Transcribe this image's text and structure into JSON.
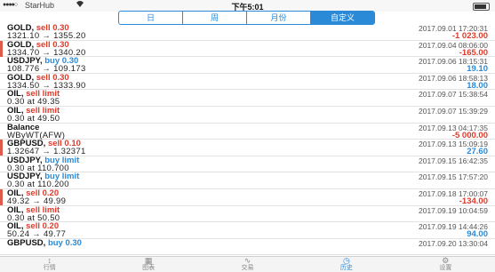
{
  "status_bar": {
    "signal": "●●●●○",
    "carrier": "StarHub",
    "wifi_icon": "wifi-icon",
    "time": "下午5:01",
    "battery_icon": "battery-icon"
  },
  "tabs": [
    {
      "label": "日",
      "active": false
    },
    {
      "label": "周",
      "active": false
    },
    {
      "label": "月份",
      "active": false
    },
    {
      "label": "自定义",
      "active": true
    }
  ],
  "partial_top_row": "1321.10 → 1355.20",
  "rows": [
    {
      "symbol": "GOLD,",
      "side": "sell",
      "side_text": "sell 0.30",
      "prices": "1321.10 → 1355.20",
      "date": "2017.09.01 17:20:31",
      "pnl": "-1 023.00",
      "pnl_sign": "neg",
      "marker": false
    },
    {
      "symbol": "GOLD,",
      "side": "sell",
      "side_text": "sell 0.30",
      "prices": "1334.70 → 1340.20",
      "date": "2017.09.04 08:06:00",
      "pnl": "-165.00",
      "pnl_sign": "neg",
      "marker": true
    },
    {
      "symbol": "USDJPY,",
      "side": "buy",
      "side_text": "buy 0.30",
      "prices": "108.776 → 109.173",
      "date": "2017.09.06 18:15:31",
      "pnl": "19.10",
      "pnl_sign": "pos",
      "marker": false
    },
    {
      "symbol": "GOLD,",
      "side": "sell",
      "side_text": "sell 0.30",
      "prices": "1334.50 → 1333.90",
      "date": "2017.09.06 18:58:13",
      "pnl": "18.00",
      "pnl_sign": "pos",
      "marker": false
    },
    {
      "symbol": "OIL,",
      "side": "sell",
      "side_text": "sell limit",
      "prices": "0.30 at 49.35",
      "date": "2017.09.07 15:38:54",
      "pnl": "",
      "pnl_sign": "",
      "marker": false
    },
    {
      "symbol": "OIL,",
      "side": "sell",
      "side_text": "sell limit",
      "prices": "0.30 at 49.50",
      "date": "2017.09.07 15:39:29",
      "pnl": "",
      "pnl_sign": "",
      "marker": false
    },
    {
      "symbol": "Balance",
      "side": "",
      "side_text": "",
      "prices": "WByWT(AFW)",
      "date": "2017.09.13 04:17:35",
      "pnl": "-5 000.00",
      "pnl_sign": "neg",
      "marker": false
    },
    {
      "symbol": "GBPUSD,",
      "side": "sell",
      "side_text": "sell 0.10",
      "prices": "1.32647 → 1.32371",
      "date": "2017.09.13 15:09:19",
      "pnl": "27.60",
      "pnl_sign": "pos",
      "marker": true
    },
    {
      "symbol": "USDJPY,",
      "side": "buy",
      "side_text": "buy limit",
      "prices": "0.30 at 110.700",
      "date": "2017.09.15 16:42:35",
      "pnl": "",
      "pnl_sign": "",
      "marker": false
    },
    {
      "symbol": "USDJPY,",
      "side": "buy",
      "side_text": "buy limit",
      "prices": "0.30 at 110.200",
      "date": "2017.09.15 17:57:20",
      "pnl": "",
      "pnl_sign": "",
      "marker": false
    },
    {
      "symbol": "OIL,",
      "side": "sell",
      "side_text": "sell 0.20",
      "prices": "49.32 → 49.99",
      "date": "2017.09.18 17:00:07",
      "pnl": "-134.00",
      "pnl_sign": "neg",
      "marker": true
    },
    {
      "symbol": "OIL,",
      "side": "sell",
      "side_text": "sell limit",
      "prices": "0.30 at 50.50",
      "date": "2017.09.19 10:04:59",
      "pnl": "",
      "pnl_sign": "",
      "marker": false
    },
    {
      "symbol": "OIL,",
      "side": "sell",
      "side_text": "sell 0.20",
      "prices": "50.24 → 49.77",
      "date": "2017.09.19 14:44:26",
      "pnl": "94.00",
      "pnl_sign": "pos",
      "marker": false
    },
    {
      "symbol": "GBPUSD,",
      "side": "buy",
      "side_text": "buy 0.30",
      "prices": "",
      "date": "2017.09.20 13:30:04",
      "pnl": "",
      "pnl_sign": "",
      "marker": false
    }
  ],
  "tabbar": [
    {
      "label": "行情",
      "icon": "quotes-icon",
      "glyph": "↕",
      "active": false
    },
    {
      "label": "图表",
      "icon": "chart-icon",
      "glyph": "▦",
      "active": false
    },
    {
      "label": "交易",
      "icon": "trade-icon",
      "glyph": "∿",
      "active": false
    },
    {
      "label": "历史",
      "icon": "history-icon",
      "glyph": "◷",
      "active": true
    },
    {
      "label": "设置",
      "icon": "settings-icon",
      "glyph": "⚙",
      "active": false
    }
  ],
  "colors": {
    "accent": "#2a8ad8",
    "sell": "#e03a2a",
    "marker": "#e05a4b"
  }
}
